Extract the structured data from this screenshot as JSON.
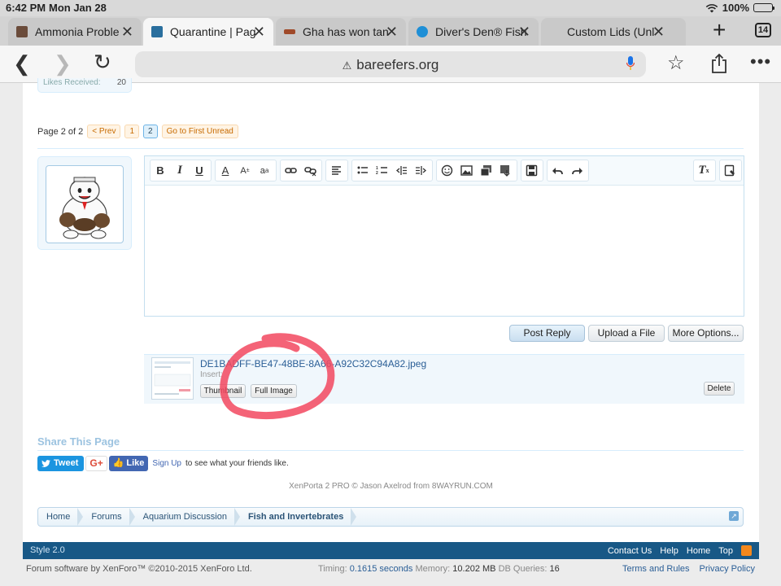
{
  "status_bar": {
    "time": "6:42 PM",
    "date": "Mon Jan 28",
    "battery": "100%"
  },
  "tabs": [
    {
      "title": "Ammonia Proble",
      "favicon_color": "#6b4c3b",
      "active": false
    },
    {
      "title": "Quarantine | Pag",
      "favicon_color": "#2a6f9e",
      "active": true
    },
    {
      "title": "Gha has won tan",
      "favicon_color": "#a04a2a",
      "active": false
    },
    {
      "title": "Diver's Den® Fish",
      "favicon_color": "#1f8fd6",
      "active": false
    },
    {
      "title": "Custom Lids (Unl",
      "favicon_color": "#cccccc",
      "active": false
    }
  ],
  "tab_count": "14",
  "url_bar": {
    "host": "bareefers.org"
  },
  "stats": {
    "label": "Likes Received:",
    "value": "20"
  },
  "pagination": {
    "label": "Page 2 of 2",
    "prev": "< Prev",
    "page1": "1",
    "page2": "2",
    "first_unread": "Go to First Unread"
  },
  "editor_buttons": {
    "post_reply": "Post Reply",
    "upload": "Upload a File",
    "more": "More Options..."
  },
  "attachment": {
    "filename": "DE1BADFF-BE47-48BE-8A66-A92C32C94A82.jpeg",
    "insert_label": "Insert:",
    "thumbnail": "Thumbnail",
    "full_image": "Full Image",
    "delete": "Delete"
  },
  "share": {
    "title": "Share This Page",
    "tweet": "Tweet",
    "gplus": "G+",
    "like": "Like",
    "signup": "Sign Up",
    "signup_suffix": "to see what your friends like."
  },
  "credit": "XenPorta 2 PRO © Jason Axelrod from 8WAYRUN.COM",
  "breadcrumb": [
    "Home",
    "Forums",
    "Aquarium Discussion",
    "Fish and Invertebrates"
  ],
  "footer": {
    "style": "Style 2.0",
    "links": [
      "Contact Us",
      "Help",
      "Home",
      "Top"
    ],
    "copyright": "Forum software by XenForo™ ©2010-2015 XenForo Ltd.",
    "timing_label": "Timing:",
    "timing_value": "0.1615 seconds",
    "memory_label": "Memory:",
    "memory_value": "10.202 MB",
    "db_label": "DB Queries:",
    "db_value": "16",
    "legal": [
      "Terms and Rules",
      "Privacy Policy"
    ]
  },
  "annotation_color": "#f2485f"
}
